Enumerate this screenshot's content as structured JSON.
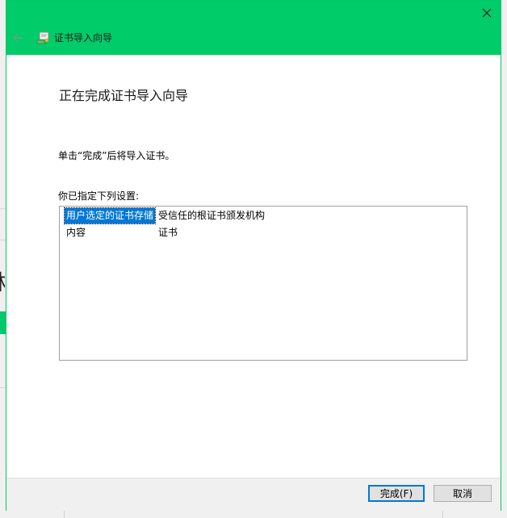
{
  "dialog": {
    "title": "证书导入向导",
    "heading": "正在完成证书导入向导",
    "instruction": "单击“完成”后将导入证书。",
    "list_label": "你已指定下列设置:",
    "settings": [
      {
        "key": "用户选定的证书存储",
        "value": "受信任的根证书颁发机构",
        "selected": true
      },
      {
        "key": "内容",
        "value": "证书",
        "selected": false
      }
    ]
  },
  "buttons": {
    "finish": "完成(F)",
    "cancel": "取消"
  },
  "colors": {
    "titlebar": "#00cc6a",
    "selection": "#0078d7"
  },
  "icons": {
    "close": "close-icon",
    "back": "back-arrow-icon",
    "wizard": "certificate-icon"
  }
}
